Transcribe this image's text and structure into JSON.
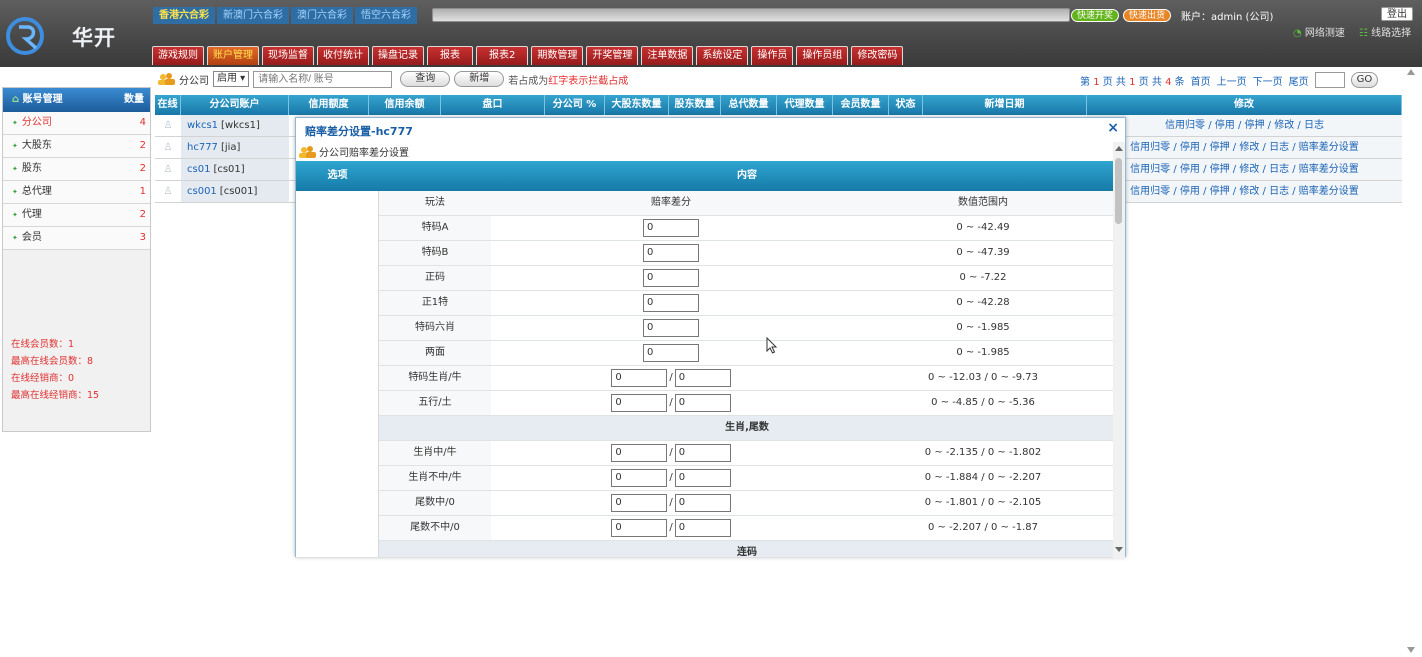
{
  "brand": "华开",
  "lottery_tabs": [
    "香港六合彩",
    "新澳门六合彩",
    "澳门六合彩",
    "悟空六合彩"
  ],
  "menu_tabs": [
    "游戏规则",
    "账户管理",
    "现场监督",
    "收付统计",
    "操盘记录",
    "报表",
    "报表2",
    "期数管理",
    "开奖管理",
    "注单数据",
    "系统设定",
    "操作员",
    "操作员组",
    "修改密码"
  ],
  "topright": {
    "pill1": "快速开奖",
    "pill2": "快速出货",
    "account": "账户：admin (公司)",
    "logout": "登出",
    "net1": "网络测速",
    "net2": "线路选择"
  },
  "sidebar": {
    "title": "账号管理",
    "count_label": "数量",
    "items": [
      {
        "label": "分公司",
        "count": "4"
      },
      {
        "label": "大股东",
        "count": "2"
      },
      {
        "label": "股东",
        "count": "2"
      },
      {
        "label": "总代理",
        "count": "1"
      },
      {
        "label": "代理",
        "count": "2"
      },
      {
        "label": "会员",
        "count": "3"
      }
    ],
    "stats": [
      "在线会员数：1",
      "最高在线会员数：8",
      "在线经销商：0",
      "最高在线经销商：15"
    ]
  },
  "filter": {
    "label": "分公司",
    "status": "启用",
    "placeholder": "请输入名称/ 账号",
    "query": "查询",
    "add": "新增",
    "hint_pre": "若占成为",
    "hint_red": "红字表示拦截占成"
  },
  "pager": {
    "p1": "第",
    "p2": "1",
    "p3": "页 共",
    "p4": "1",
    "p5": "页 共",
    "p6": "4",
    "p7": "条",
    "first": "首页",
    "prev": "上一页",
    "next": "下一页",
    "last": "尾页",
    "go": "GO"
  },
  "table": {
    "headers": [
      "在线",
      "分公司账户",
      "信用额度",
      "信用余额",
      "盘口",
      "分公司 %",
      "大股东数量",
      "股东数量",
      "总代数量",
      "代理数量",
      "会员数量",
      "状态",
      "新增日期",
      "修改"
    ],
    "rows": [
      {
        "acct": "wkcs1",
        "name": "[wkcs1]",
        "ops": "信用归零 / 停用 / 停押 / 修改 / 日志"
      },
      {
        "acct": "hc777",
        "name": "[jia]",
        "ops": "信用归零 / 停用 / 停押 / 修改 / 日志 / 赔率差分设置"
      },
      {
        "acct": "cs01",
        "name": "[cs01]",
        "ops": "信用归零 / 停用 / 停押 / 修改 / 日志 / 赔率差分设置"
      },
      {
        "acct": "cs001",
        "name": "[cs001]",
        "ops": "信用归零 / 停用 / 停押 / 修改 / 日志 / 赔率差分设置"
      }
    ]
  },
  "modal": {
    "title": "赔率差分设置-hc777",
    "close": "×",
    "subtitle": "分公司赔率差分设置",
    "col_option": "选项",
    "col_content": "内容",
    "sub_headers": [
      "玩法",
      "赔率差分",
      "数值范围内"
    ],
    "rows": [
      {
        "type": "single",
        "name": "特码A",
        "v": "0",
        "range": "0 ~ -42.49"
      },
      {
        "type": "single",
        "name": "特码B",
        "v": "0",
        "range": "0 ~ -47.39"
      },
      {
        "type": "single",
        "name": "正码",
        "v": "0",
        "range": "0 ~ -7.22"
      },
      {
        "type": "single",
        "name": "正1特",
        "v": "0",
        "range": "0 ~ -42.28"
      },
      {
        "type": "single",
        "name": "特码六肖",
        "v": "0",
        "range": "0 ~ -1.985"
      },
      {
        "type": "single",
        "name": "两面",
        "v": "0",
        "range": "0 ~ -1.985"
      },
      {
        "type": "double",
        "name": "特码生肖/牛",
        "v1": "0",
        "v2": "0",
        "range": "0 ~ -12.03 / 0 ~ -9.73"
      },
      {
        "type": "double",
        "name": "五行/土",
        "v1": "0",
        "v2": "0",
        "range": "0 ~ -4.85 / 0 ~ -5.36"
      },
      {
        "type": "section",
        "name": "生肖,尾数"
      },
      {
        "type": "double",
        "name": "生肖中/牛",
        "v1": "0",
        "v2": "0",
        "range": "0 ~ -2.135 / 0 ~ -1.802"
      },
      {
        "type": "double",
        "name": "生肖不中/牛",
        "v1": "0",
        "v2": "0",
        "range": "0 ~ -1.884 / 0 ~ -2.207"
      },
      {
        "type": "double",
        "name": "尾数中/0",
        "v1": "0",
        "v2": "0",
        "range": "0 ~ -1.801 / 0 ~ -2.105"
      },
      {
        "type": "double",
        "name": "尾数不中/0",
        "v1": "0",
        "v2": "0",
        "range": "0 ~ -2.207 / 0 ~ -1.87"
      },
      {
        "type": "section",
        "name": "连码"
      }
    ]
  },
  "colors": {
    "header_bg": "#474747",
    "menu_red": "#b22222",
    "table_head": "#1f8fc0",
    "accent_blue": "#1a63b6",
    "red_text": "#e03030"
  }
}
